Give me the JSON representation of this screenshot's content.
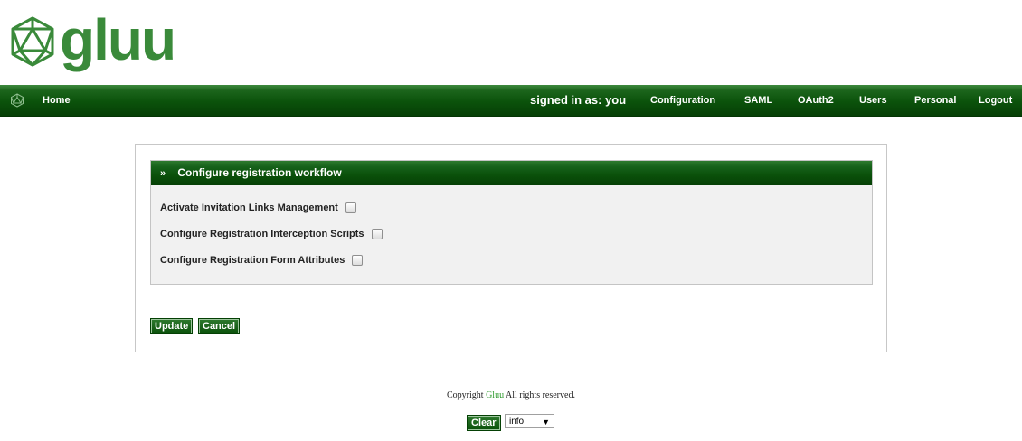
{
  "brand": {
    "logo_text": "gluu",
    "logo_icon": "gluu-icosahedron-icon"
  },
  "nav": {
    "home": "Home",
    "signed_in": "signed in as: you",
    "items": [
      {
        "label": "Configuration"
      },
      {
        "label": "SAML"
      },
      {
        "label": "OAuth2"
      },
      {
        "label": "Users"
      },
      {
        "label": "Personal"
      },
      {
        "label": "Logout"
      }
    ]
  },
  "panel": {
    "title": "Configure registration workflow",
    "toggle_icon": "double-chevron-down-icon",
    "options": [
      {
        "label": "Activate Invitation Links Management",
        "checked": false
      },
      {
        "label": "Configure Registration Interception Scripts",
        "checked": false
      },
      {
        "label": "Configure Registration Form Attributes",
        "checked": false
      }
    ]
  },
  "actions": {
    "update": "Update",
    "cancel": "Cancel"
  },
  "footer": {
    "prefix": "Copyright",
    "link": "Gluu",
    "suffix": "All rights reserved.",
    "clear": "Clear",
    "log_level": "info"
  },
  "colors": {
    "brand_green": "#0b520b",
    "logo_green": "#3a8a3a"
  }
}
